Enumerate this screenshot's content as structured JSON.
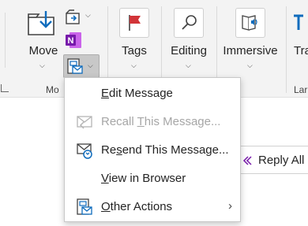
{
  "ribbon": {
    "move": {
      "label": "Move"
    },
    "move_group_label": "Mo",
    "tags": {
      "label": "Tags"
    },
    "editing": {
      "label": "Editing"
    },
    "immersive": {
      "label": "Immersive"
    },
    "translate": {
      "label": "Tra"
    },
    "lang_group_label": "Lar"
  },
  "reply_all": {
    "label": "Reply All"
  },
  "menu": {
    "items": [
      {
        "label": "Edit Message",
        "mnemonic": "E",
        "rest": "dit Message",
        "disabled": false,
        "icon": "none"
      },
      {
        "label": "Recall This Message...",
        "pre": "Recall ",
        "mnemonic": "T",
        "rest": "his Message...",
        "disabled": true,
        "icon": "recall-envelope-icon"
      },
      {
        "label": "Resend This Message...",
        "pre": "Re",
        "mnemonic": "s",
        "rest": "end This Message...",
        "disabled": false,
        "icon": "resend-envelope-icon"
      },
      {
        "label": "View in Browser",
        "mnemonic": "V",
        "rest": "iew in Browser",
        "disabled": false,
        "icon": "none"
      },
      {
        "label": "Other Actions",
        "mnemonic": "O",
        "rest": "ther Actions",
        "disabled": false,
        "icon": "other-actions-icon",
        "submenu": true
      }
    ]
  },
  "colors": {
    "accent": "#0f6cbd",
    "flag_red": "#d13438",
    "onenote_purple": "#7719aa",
    "disabled_text": "#a6a6a6"
  }
}
